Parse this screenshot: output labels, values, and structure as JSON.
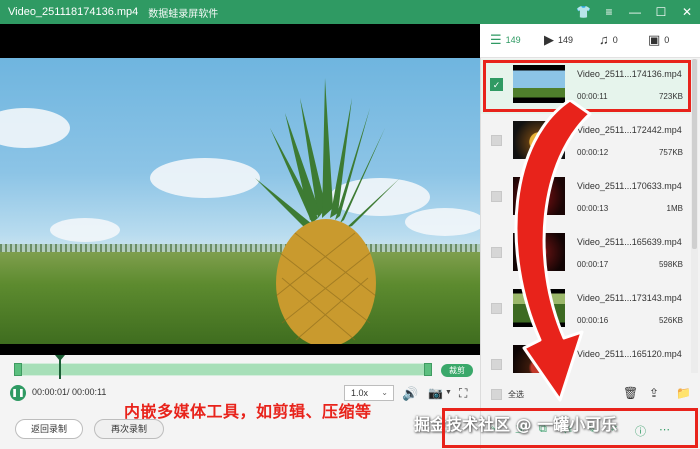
{
  "window": {
    "title": "Video_251118174136.mp4",
    "app_name": "数据蛙录屏软件",
    "controls": [
      "skin-icon",
      "menu-icon",
      "minimize-icon",
      "maximize-icon",
      "close-icon"
    ]
  },
  "player": {
    "trim_label": "裁剪",
    "time_display": "00:00:01/ 00:00:11",
    "speed": "1.0x",
    "progress_fraction": 0.11
  },
  "actions": {
    "back_label": "返回录制",
    "again_label": "再次录制"
  },
  "annotation": {
    "text": "内嵌多媒体工具，如剪辑、压缩等",
    "color": "#e8231b"
  },
  "tabs": [
    {
      "icon": "list-icon",
      "count": "149",
      "active": true
    },
    {
      "icon": "video-icon",
      "count": "149",
      "active": false
    },
    {
      "icon": "music-icon",
      "count": "0",
      "active": false
    },
    {
      "icon": "image-icon",
      "count": "0",
      "active": false
    }
  ],
  "files": [
    {
      "name": "Video_2511...174136.mp4",
      "duration": "00:00:11",
      "size": "723KB",
      "selected": true
    },
    {
      "name": "Video_2511...172442.mp4",
      "duration": "00:00:12",
      "size": "757KB",
      "selected": false
    },
    {
      "name": "Video_2511...170633.mp4",
      "duration": "00:00:13",
      "size": "1MB",
      "selected": false
    },
    {
      "name": "Video_2511...165639.mp4",
      "duration": "00:00:17",
      "size": "598KB",
      "selected": false
    },
    {
      "name": "Video_2511...173143.mp4",
      "duration": "00:00:16",
      "size": "526KB",
      "selected": false
    },
    {
      "name": "Video_2511...165120.mp4",
      "duration": "",
      "size": "",
      "selected": false
    }
  ],
  "list_footer": {
    "select_all_label": "全选"
  },
  "watermark": "掘金技术社区 @ 一罐小可乐",
  "colors": {
    "accent": "#2f9a63",
    "annotation_red": "#e8231b"
  }
}
